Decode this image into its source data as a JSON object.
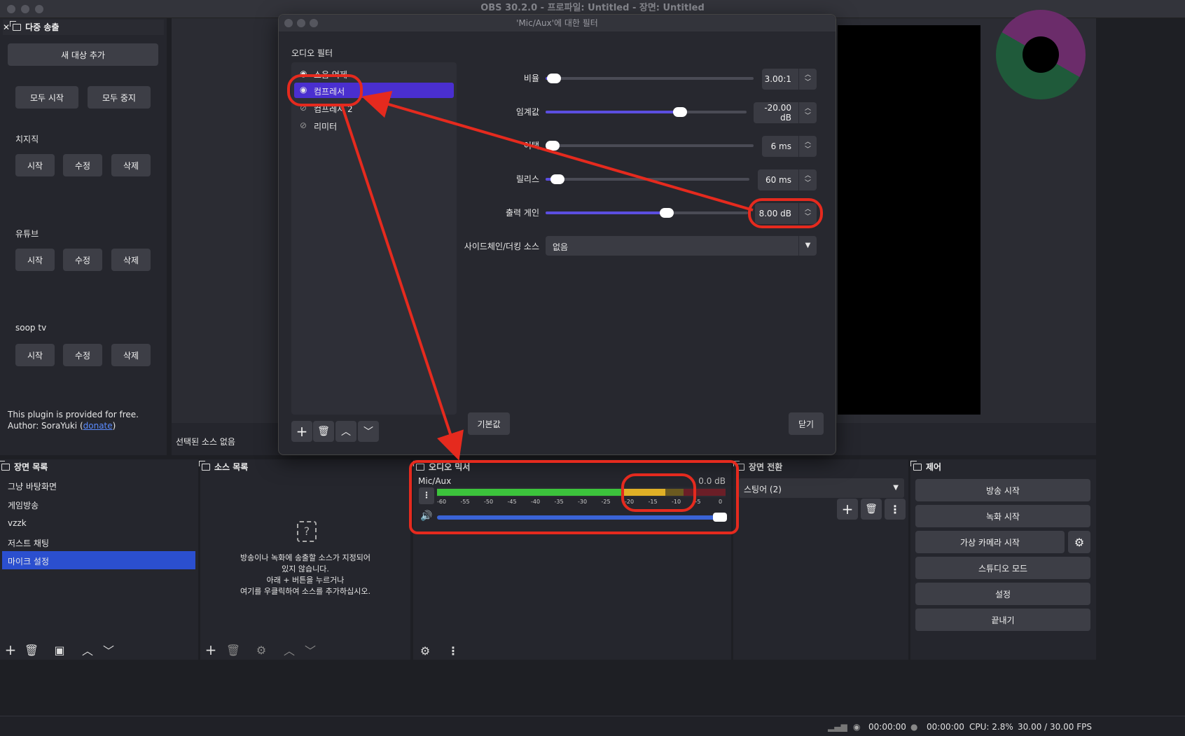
{
  "window": {
    "title": "OBS 30.2.0 - 프로파일: Untitled - 장면: Untitled"
  },
  "multistream": {
    "title": "다중 송출",
    "add_target": "새 대상 추가",
    "start_all": "모두 시작",
    "stop_all": "모두 중지",
    "targets": [
      {
        "name": "치지직",
        "start": "시작",
        "edit": "수정",
        "delete": "삭제"
      },
      {
        "name": "유튜브",
        "start": "시작",
        "edit": "수정",
        "delete": "삭제"
      },
      {
        "name": "soop tv",
        "start": "시작",
        "edit": "수정",
        "delete": "삭제"
      }
    ],
    "footer_line1": "This plugin is provided for free.",
    "footer_author": "Author: SoraYuki (",
    "footer_link": "donate",
    "footer_end": ")"
  },
  "preview": {
    "no_source": "선택된 소스 없음"
  },
  "filter_dialog": {
    "title": "'Mic/Aux'에 대한 필터",
    "section": "오디오 필터",
    "filters": [
      {
        "name": "소음 억제",
        "enabled": true
      },
      {
        "name": "컴프레서",
        "enabled": true,
        "selected": true
      },
      {
        "name": "컴프레서 2",
        "enabled": false
      },
      {
        "name": "리미터",
        "enabled": false
      }
    ],
    "params": {
      "ratio": {
        "label": "비율",
        "value": "3.00:1",
        "level": 0.04
      },
      "threshold": {
        "label": "임계값",
        "value": "-20.00 dB",
        "level": 0.67
      },
      "attack": {
        "label": "어택",
        "value": "6 ms",
        "level": 0.01
      },
      "release": {
        "label": "릴리스",
        "value": "60 ms",
        "level": 0.06
      },
      "output_gain": {
        "label": "출력 게인",
        "value": "8.00 dB",
        "level": 0.6
      },
      "sidechain": {
        "label": "사이드체인/더킹 소스",
        "value": "없음"
      }
    },
    "defaults_button": "기본값",
    "close_button": "닫기"
  },
  "scenes": {
    "title": "장면 목록",
    "items": [
      "그냥 바탕화면",
      "게임방송",
      "vzzk",
      "저스트 채팅",
      "마이크 설정"
    ],
    "selected_index": 4
  },
  "sources": {
    "title": "소스 목록",
    "empty_line1": "방송이나 녹화에 송출할 소스가 지정되어",
    "empty_line2": "있지 않습니다.",
    "empty_line3": "아래 + 버튼을 누르거나",
    "empty_line4": "여기를 우클릭하여 소스를 추가하십시오."
  },
  "mixer": {
    "title": "오디오 믹서",
    "channel": "Mic/Aux",
    "db": "0.0 dB",
    "ticks": [
      "-60",
      "-55",
      "-50",
      "-45",
      "-40",
      "-35",
      "-30",
      "-25",
      "-20",
      "-15",
      "-10",
      "-5",
      "0"
    ],
    "volume": 1.0
  },
  "transitions": {
    "title": "장면 전환",
    "selected": "스팅어 (2)"
  },
  "controls": {
    "title": "제어",
    "start_stream": "방송 시작",
    "start_record": "녹화 시작",
    "virtual_cam": "가상 카메라 시작",
    "studio_mode": "스튜디오 모드",
    "settings": "설정",
    "exit": "끝내기"
  },
  "statusbar": {
    "stream_time": "00:00:00",
    "record_time": "00:00:00",
    "cpu": "CPU: 2.8%",
    "fps": "30.00 / 30.00 FPS"
  },
  "colors": {
    "accent": "#5b4ee0",
    "selection": "#2b4fcf",
    "highlight": "#e52a1e",
    "meter_green": "#3cc33c",
    "meter_yellow": "#e0b026",
    "meter_red": "#b8202c"
  }
}
